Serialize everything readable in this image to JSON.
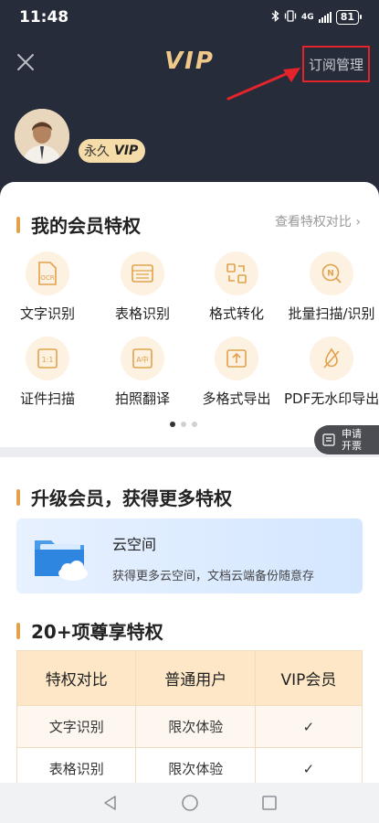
{
  "status": {
    "time": "11:48",
    "network": "4G",
    "battery": "81"
  },
  "header": {
    "title": "VIP",
    "manage_label": "订阅管理"
  },
  "user": {
    "tier_prefix": "永久",
    "tier_badge": "VIP"
  },
  "privileges": {
    "title": "我的会员特权",
    "compare_link": "查看特权对比",
    "items": [
      {
        "label": "文字识别",
        "icon": "ocr-doc-icon",
        "icon_text": "OCR"
      },
      {
        "label": "表格识别",
        "icon": "table-icon"
      },
      {
        "label": "格式转化",
        "icon": "convert-icon"
      },
      {
        "label": "批量扫描/识别",
        "icon": "batch-scan-icon",
        "icon_text": "N"
      },
      {
        "label": "证件扫描",
        "icon": "id-card-icon",
        "icon_text": "1:1"
      },
      {
        "label": "拍照翻译",
        "icon": "translate-icon",
        "icon_text": "A中"
      },
      {
        "label": "多格式导出",
        "icon": "export-icon"
      },
      {
        "label": "PDF无水印导出",
        "icon": "no-watermark-icon"
      }
    ],
    "page_count": 3,
    "active_page": 0
  },
  "invoice": {
    "line1": "申请",
    "line2": "开票"
  },
  "upgrade": {
    "title": "升级会员，获得更多特权",
    "cloud_title": "云空间",
    "cloud_desc": "获得更多云空间，文档云端备份随意存"
  },
  "compare": {
    "title": "20+项尊享特权",
    "headers": [
      "特权对比",
      "普通用户",
      "VIP会员"
    ],
    "rows": [
      {
        "feature": "文字识别",
        "normal": "限次体验",
        "vip": "✓"
      },
      {
        "feature": "表格识别",
        "normal": "限次体验",
        "vip": "✓"
      }
    ]
  },
  "colors": {
    "header_bg": "#262c3a",
    "gold": "#f0c88a",
    "accent": "#e2a14a",
    "highlight": "#e3242b",
    "check": "#3fae6a"
  }
}
